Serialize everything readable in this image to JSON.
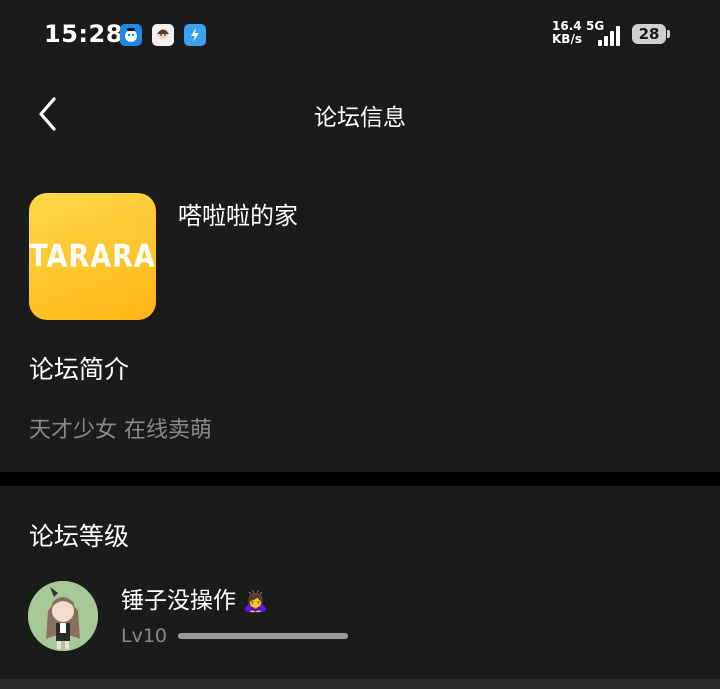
{
  "status_bar": {
    "time": "15:28",
    "net_speed_value": "16.4",
    "net_speed_unit": "KB/s",
    "network_type": "5G",
    "battery": "28",
    "app_icons": [
      "robot-app-icon",
      "avatar-app-icon",
      "lightning-app-icon"
    ]
  },
  "header": {
    "title": "论坛信息"
  },
  "forum": {
    "logo_text": "TARARA",
    "name": "嗒啦啦的家",
    "intro_title": "论坛简介",
    "intro_text": "天才少女 在线卖萌"
  },
  "level_section": {
    "title": "论坛等级",
    "user": {
      "name": "锤子没操作",
      "emoji": "🙇‍♀️",
      "level": "Lv10",
      "progress": 1.0
    }
  },
  "colors": {
    "background": "#1b1b1b",
    "secondary_text": "#8a8a8a",
    "logo_yellow": "#ffc42a",
    "divider": "#000000"
  }
}
